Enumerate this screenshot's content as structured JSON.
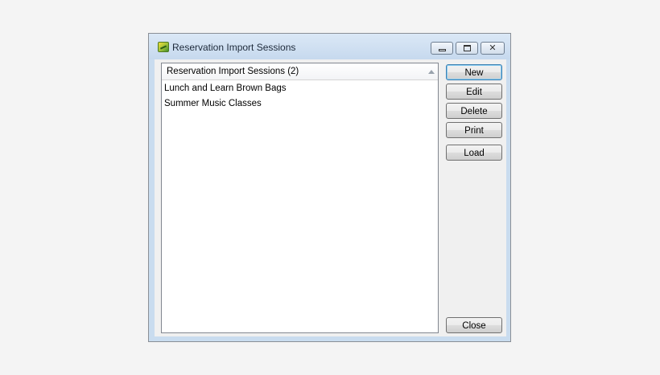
{
  "window": {
    "title": "Reservation Import Sessions",
    "close_glyph": "✕"
  },
  "list": {
    "header": "Reservation Import Sessions (2)",
    "items": [
      "Lunch and Learn Brown Bags",
      "Summer Music Classes"
    ]
  },
  "buttons": {
    "new": "New",
    "edit": "Edit",
    "delete": "Delete",
    "print": "Print",
    "load": "Load",
    "close": "Close"
  }
}
